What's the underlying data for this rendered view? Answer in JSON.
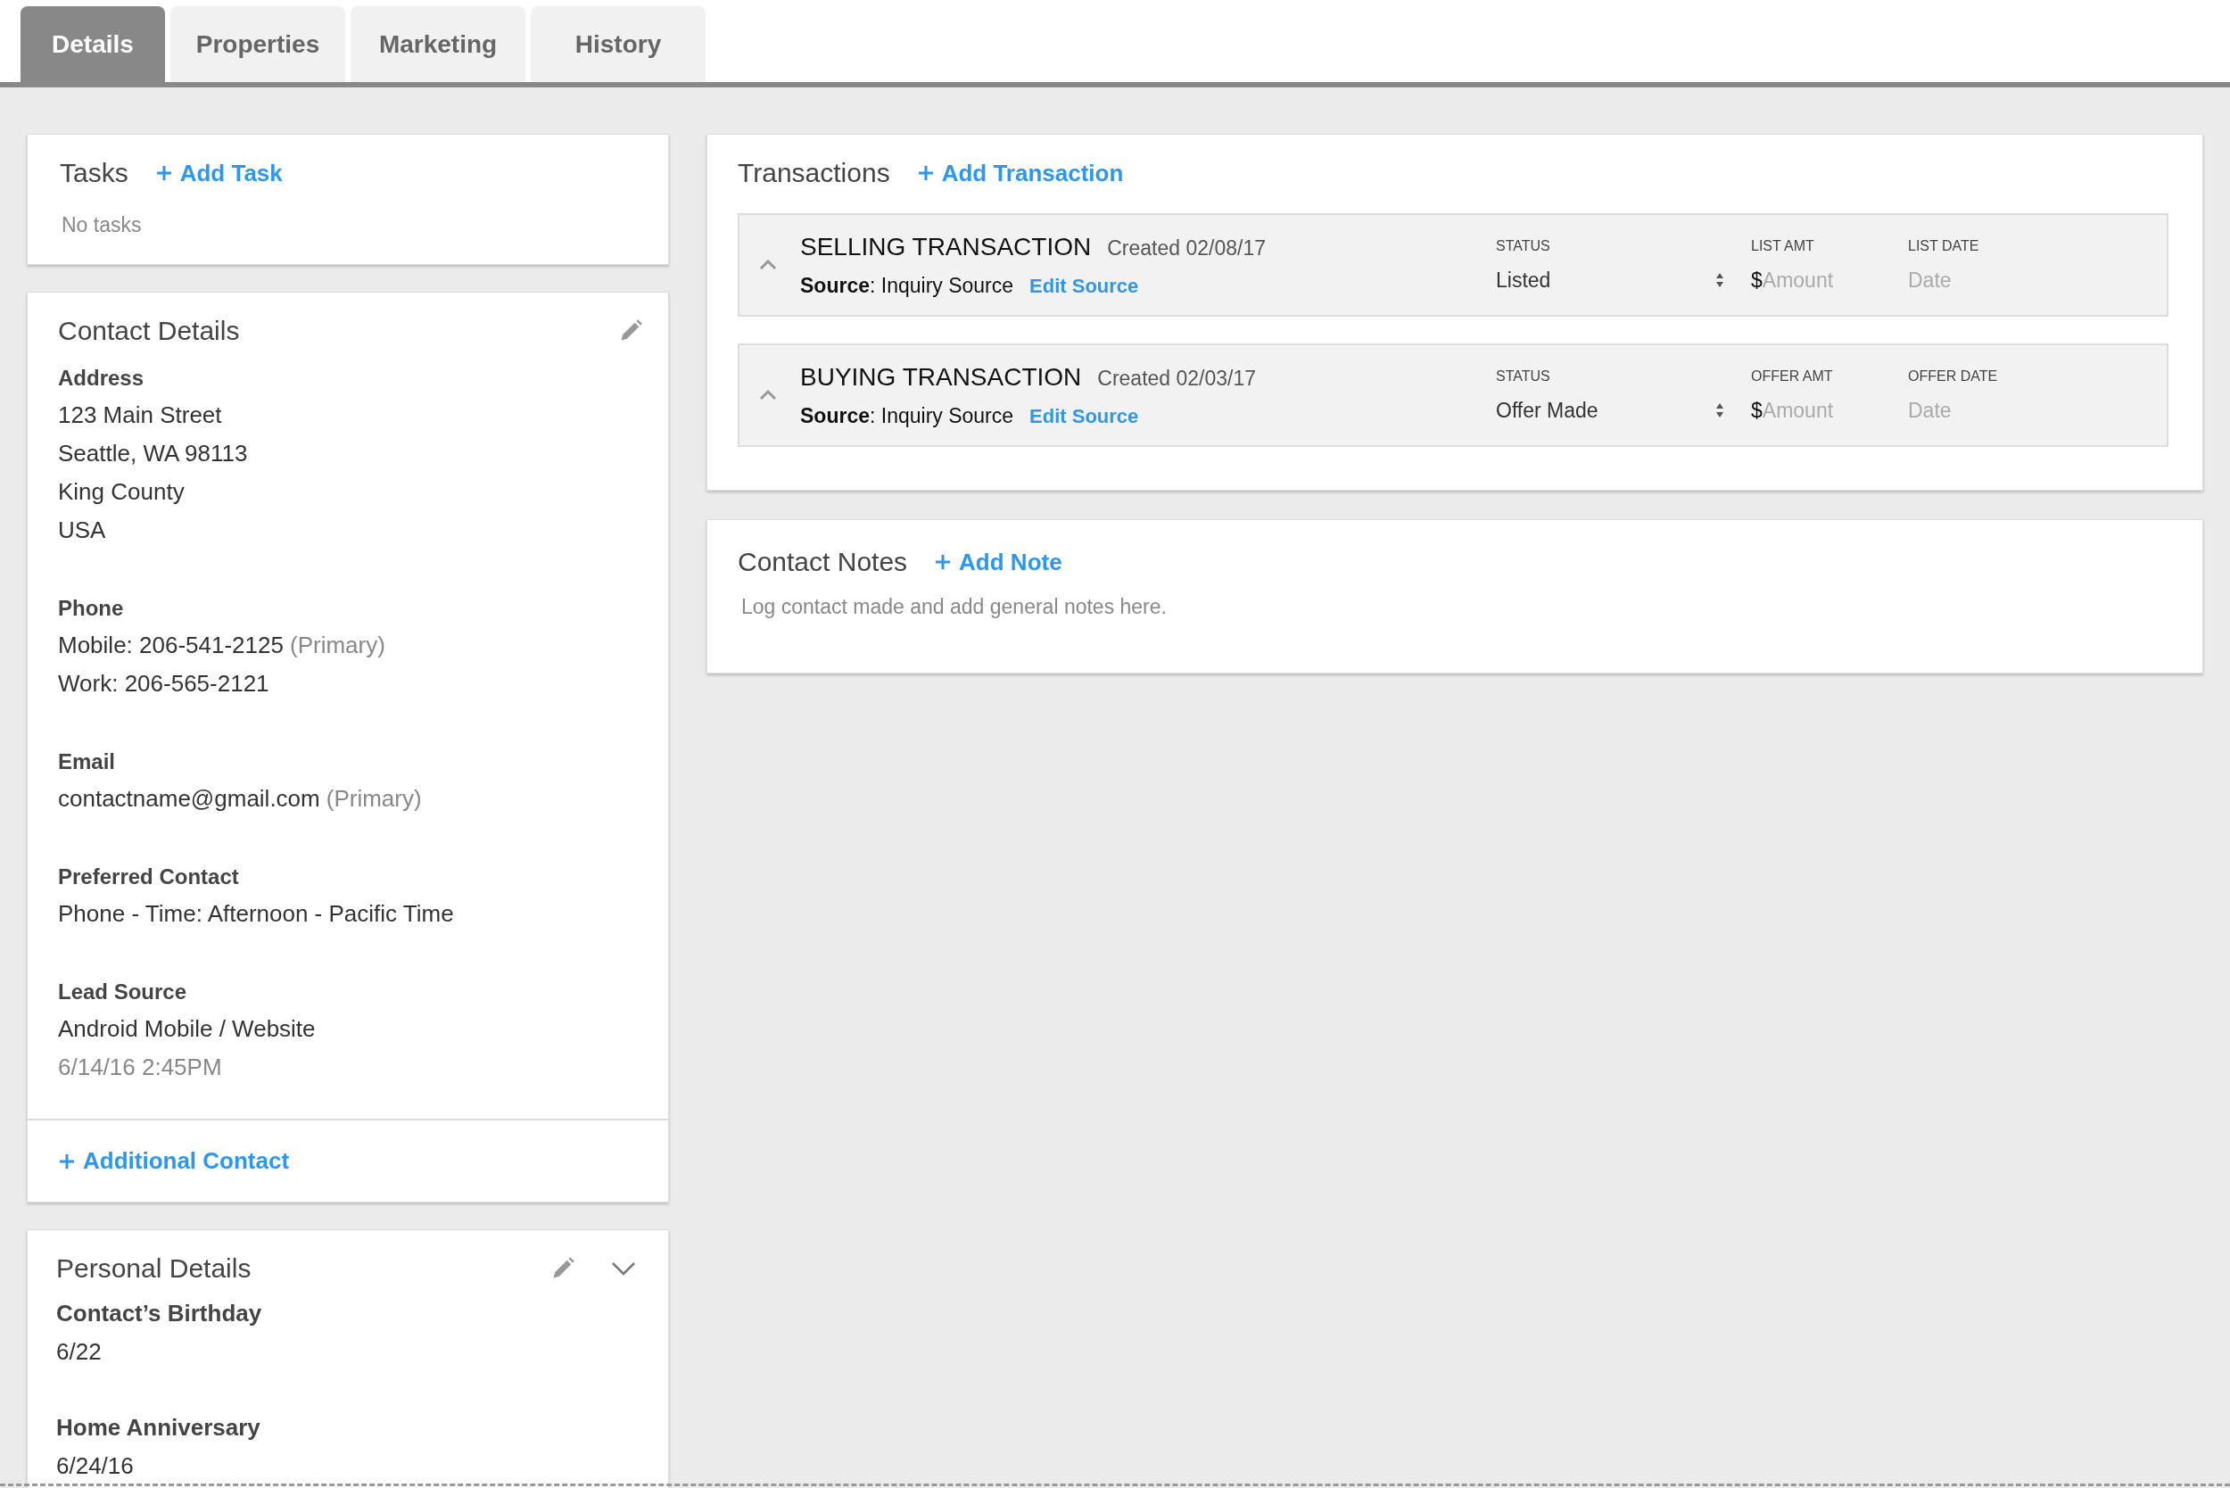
{
  "tabs": [
    {
      "label": "Details",
      "selected": true
    },
    {
      "label": "Properties",
      "selected": false
    },
    {
      "label": "Marketing",
      "selected": false
    },
    {
      "label": "History",
      "selected": false
    }
  ],
  "tasks": {
    "title": "Tasks",
    "add_link": "Add Task",
    "empty_text": "No tasks"
  },
  "contact_details": {
    "title": "Contact Details",
    "sections": [
      {
        "label": "Address",
        "lines": [
          {
            "kind": "value",
            "text": "123 Main Street"
          },
          {
            "kind": "value",
            "text": "Seattle, WA 98113"
          },
          {
            "kind": "value",
            "text": "King County"
          },
          {
            "kind": "value",
            "text": "USA"
          }
        ]
      },
      {
        "label": "Phone",
        "lines": [
          {
            "kind": "value",
            "text": "Mobile: 206-541-2125",
            "note": "(Primary)"
          },
          {
            "kind": "value",
            "text": "Work: 206-565-2121"
          }
        ]
      },
      {
        "label": "Email",
        "lines": [
          {
            "kind": "value",
            "text": "contactname@gmail.com",
            "note": "(Primary)"
          }
        ]
      },
      {
        "label": "Preferred Contact",
        "lines": [
          {
            "kind": "value",
            "text": "Phone - Time: Afternoon - Pacific Time"
          }
        ]
      },
      {
        "label": "Lead Source",
        "lines": [
          {
            "kind": "value",
            "text": "Android Mobile / Website"
          },
          {
            "kind": "timestamp",
            "text": "6/14/16 2:45PM"
          }
        ]
      }
    ],
    "add_link": "Additional Contact"
  },
  "personal_details": {
    "title": "Personal Details",
    "expanded": false,
    "sections": [
      {
        "label": "Contact’s Birthday",
        "value": "6/22"
      },
      {
        "label": "Home Anniversary",
        "value": "6/24/16"
      }
    ]
  },
  "transactions": {
    "title": "Transactions",
    "add_link": "Add Transaction",
    "items": [
      {
        "title": "SELLING TRANSACTION",
        "created": "Created 02/08/17",
        "source": "**Source**: Inquiry Source",
        "edit_link": "Edit Source",
        "status_label": "STATUS",
        "status": "Listed",
        "amount_label": "LIST AMT",
        "currency": "$",
        "amount_placeholder": "Amount",
        "date_label": "LIST DATE",
        "date_placeholder": "Date",
        "expanded": true
      },
      {
        "title": "BUYING TRANSACTION",
        "created": "Created 02/03/17",
        "source": "**Source**: Inquiry Source",
        "edit_link": "Edit Source",
        "status_label": "STATUS",
        "status": "Offer Made",
        "amount_label": "OFFER AMT",
        "currency": "$",
        "amount_placeholder": "Amount",
        "date_label": "OFFER DATE",
        "date_placeholder": "Date",
        "expanded": true
      }
    ]
  },
  "contact_notes": {
    "title": "Contact Notes",
    "add_link": "Add Note",
    "placeholder": "Log contact made and add general notes here."
  }
}
